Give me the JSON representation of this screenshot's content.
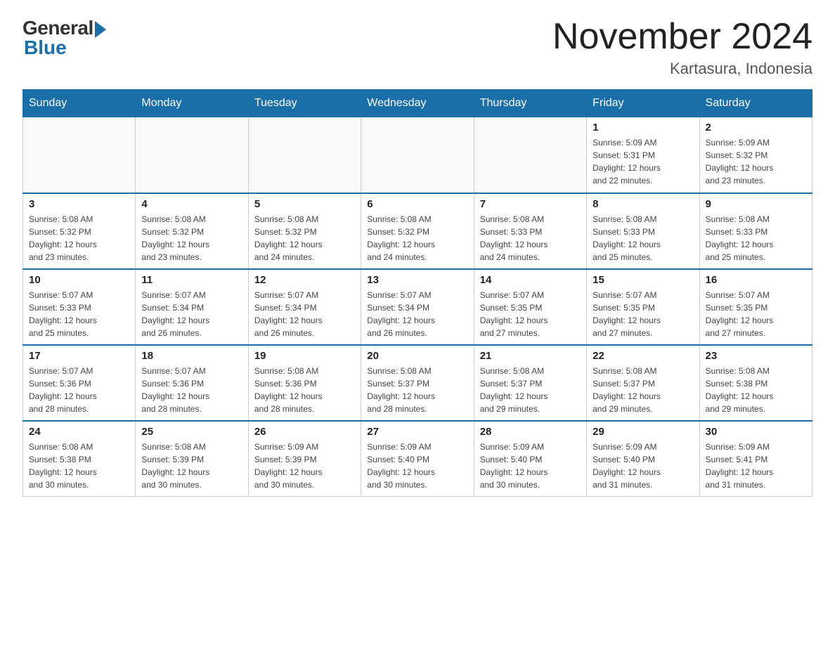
{
  "header": {
    "logo_general": "General",
    "logo_blue": "Blue",
    "month_title": "November 2024",
    "location": "Kartasura, Indonesia"
  },
  "days_of_week": [
    "Sunday",
    "Monday",
    "Tuesday",
    "Wednesday",
    "Thursday",
    "Friday",
    "Saturday"
  ],
  "weeks": [
    [
      {
        "day": "",
        "info": ""
      },
      {
        "day": "",
        "info": ""
      },
      {
        "day": "",
        "info": ""
      },
      {
        "day": "",
        "info": ""
      },
      {
        "day": "",
        "info": ""
      },
      {
        "day": "1",
        "info": "Sunrise: 5:09 AM\nSunset: 5:31 PM\nDaylight: 12 hours\nand 22 minutes."
      },
      {
        "day": "2",
        "info": "Sunrise: 5:09 AM\nSunset: 5:32 PM\nDaylight: 12 hours\nand 23 minutes."
      }
    ],
    [
      {
        "day": "3",
        "info": "Sunrise: 5:08 AM\nSunset: 5:32 PM\nDaylight: 12 hours\nand 23 minutes."
      },
      {
        "day": "4",
        "info": "Sunrise: 5:08 AM\nSunset: 5:32 PM\nDaylight: 12 hours\nand 23 minutes."
      },
      {
        "day": "5",
        "info": "Sunrise: 5:08 AM\nSunset: 5:32 PM\nDaylight: 12 hours\nand 24 minutes."
      },
      {
        "day": "6",
        "info": "Sunrise: 5:08 AM\nSunset: 5:32 PM\nDaylight: 12 hours\nand 24 minutes."
      },
      {
        "day": "7",
        "info": "Sunrise: 5:08 AM\nSunset: 5:33 PM\nDaylight: 12 hours\nand 24 minutes."
      },
      {
        "day": "8",
        "info": "Sunrise: 5:08 AM\nSunset: 5:33 PM\nDaylight: 12 hours\nand 25 minutes."
      },
      {
        "day": "9",
        "info": "Sunrise: 5:08 AM\nSunset: 5:33 PM\nDaylight: 12 hours\nand 25 minutes."
      }
    ],
    [
      {
        "day": "10",
        "info": "Sunrise: 5:07 AM\nSunset: 5:33 PM\nDaylight: 12 hours\nand 25 minutes."
      },
      {
        "day": "11",
        "info": "Sunrise: 5:07 AM\nSunset: 5:34 PM\nDaylight: 12 hours\nand 26 minutes."
      },
      {
        "day": "12",
        "info": "Sunrise: 5:07 AM\nSunset: 5:34 PM\nDaylight: 12 hours\nand 26 minutes."
      },
      {
        "day": "13",
        "info": "Sunrise: 5:07 AM\nSunset: 5:34 PM\nDaylight: 12 hours\nand 26 minutes."
      },
      {
        "day": "14",
        "info": "Sunrise: 5:07 AM\nSunset: 5:35 PM\nDaylight: 12 hours\nand 27 minutes."
      },
      {
        "day": "15",
        "info": "Sunrise: 5:07 AM\nSunset: 5:35 PM\nDaylight: 12 hours\nand 27 minutes."
      },
      {
        "day": "16",
        "info": "Sunrise: 5:07 AM\nSunset: 5:35 PM\nDaylight: 12 hours\nand 27 minutes."
      }
    ],
    [
      {
        "day": "17",
        "info": "Sunrise: 5:07 AM\nSunset: 5:36 PM\nDaylight: 12 hours\nand 28 minutes."
      },
      {
        "day": "18",
        "info": "Sunrise: 5:07 AM\nSunset: 5:36 PM\nDaylight: 12 hours\nand 28 minutes."
      },
      {
        "day": "19",
        "info": "Sunrise: 5:08 AM\nSunset: 5:36 PM\nDaylight: 12 hours\nand 28 minutes."
      },
      {
        "day": "20",
        "info": "Sunrise: 5:08 AM\nSunset: 5:37 PM\nDaylight: 12 hours\nand 28 minutes."
      },
      {
        "day": "21",
        "info": "Sunrise: 5:08 AM\nSunset: 5:37 PM\nDaylight: 12 hours\nand 29 minutes."
      },
      {
        "day": "22",
        "info": "Sunrise: 5:08 AM\nSunset: 5:37 PM\nDaylight: 12 hours\nand 29 minutes."
      },
      {
        "day": "23",
        "info": "Sunrise: 5:08 AM\nSunset: 5:38 PM\nDaylight: 12 hours\nand 29 minutes."
      }
    ],
    [
      {
        "day": "24",
        "info": "Sunrise: 5:08 AM\nSunset: 5:38 PM\nDaylight: 12 hours\nand 30 minutes."
      },
      {
        "day": "25",
        "info": "Sunrise: 5:08 AM\nSunset: 5:39 PM\nDaylight: 12 hours\nand 30 minutes."
      },
      {
        "day": "26",
        "info": "Sunrise: 5:09 AM\nSunset: 5:39 PM\nDaylight: 12 hours\nand 30 minutes."
      },
      {
        "day": "27",
        "info": "Sunrise: 5:09 AM\nSunset: 5:40 PM\nDaylight: 12 hours\nand 30 minutes."
      },
      {
        "day": "28",
        "info": "Sunrise: 5:09 AM\nSunset: 5:40 PM\nDaylight: 12 hours\nand 30 minutes."
      },
      {
        "day": "29",
        "info": "Sunrise: 5:09 AM\nSunset: 5:40 PM\nDaylight: 12 hours\nand 31 minutes."
      },
      {
        "day": "30",
        "info": "Sunrise: 5:09 AM\nSunset: 5:41 PM\nDaylight: 12 hours\nand 31 minutes."
      }
    ]
  ]
}
